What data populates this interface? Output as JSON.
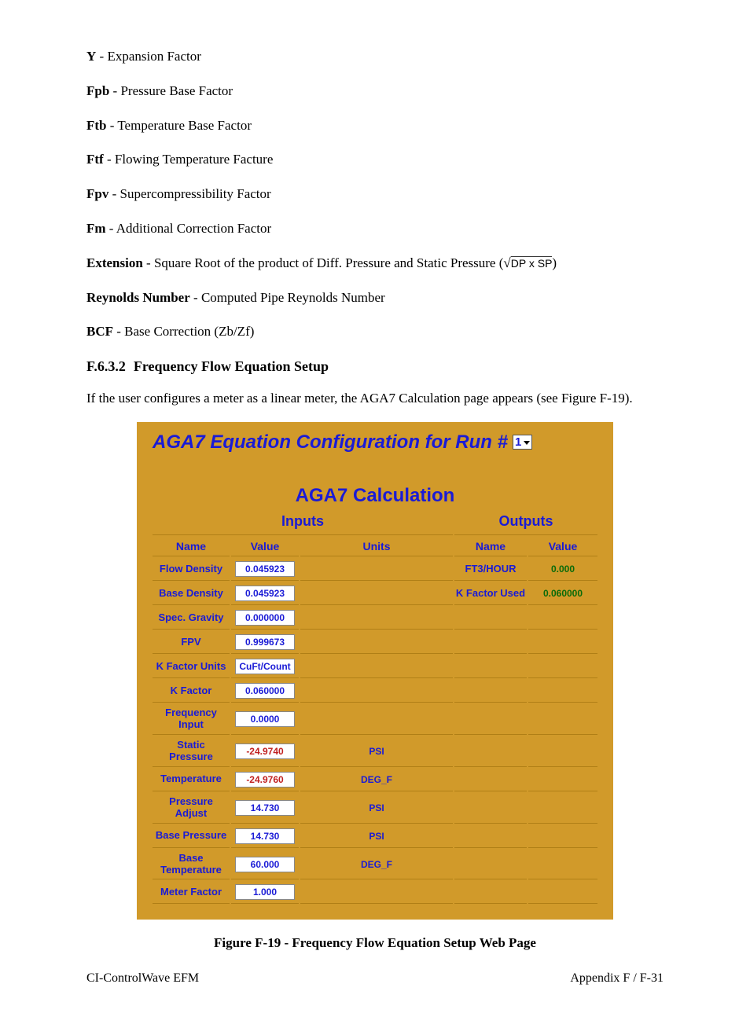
{
  "defs": [
    {
      "sym": "Y",
      "desc": "Expansion Factor"
    },
    {
      "sym": "Fpb",
      "desc": "Pressure Base Factor"
    },
    {
      "sym": "Ftb",
      "desc": "Temperature Base Factor"
    },
    {
      "sym": "Ftf",
      "desc": "Flowing Temperature Facture"
    },
    {
      "sym": "Fpv",
      "desc": "Supercompressibility Factor"
    },
    {
      "sym": "Fm",
      "desc": "Additional Correction Factor"
    }
  ],
  "ext": {
    "sym": "Extension",
    "desc": "Square Root of the product of Diff. Pressure and Static Pressure (",
    "sqrt": "DP x SP",
    "close": ")"
  },
  "reynolds": {
    "sym": "Reynolds Number",
    "desc": "Computed Pipe Reynolds Number"
  },
  "bcf": {
    "sym": "BCF",
    "desc": "Base Correction (Zb/Zf)"
  },
  "section": {
    "num": "F.6.3.2",
    "title": "Frequency Flow Equation Setup"
  },
  "para": "If the user configures a meter as a linear meter, the AGA7 Calculation page appears (see Figure F-19).",
  "aga7": {
    "title": "AGA7 Equation Configuration for Run #",
    "run": "1",
    "calc_title": "AGA7 Calculation",
    "inputs_hdr": "Inputs",
    "outputs_hdr": "Outputs",
    "col_name": "Name",
    "col_value": "Value",
    "col_units": "Units",
    "inputs": [
      {
        "name": "Flow Density",
        "value": "0.045923",
        "units": ""
      },
      {
        "name": "Base Density",
        "value": "0.045923",
        "units": ""
      },
      {
        "name": "Spec. Gravity",
        "value": "0.000000",
        "units": ""
      },
      {
        "name": "FPV",
        "value": "0.999673",
        "units": ""
      },
      {
        "name": "K Factor Units",
        "value": "CuFt/Count",
        "units": ""
      },
      {
        "name": "K Factor",
        "value": "0.060000",
        "units": ""
      },
      {
        "name": "Frequency Input",
        "value": "0.0000",
        "units": ""
      },
      {
        "name": "Static Pressure",
        "value": "-24.9740",
        "units": "PSI",
        "neg": true
      },
      {
        "name": "Temperature",
        "value": "-24.9760",
        "units": "DEG_F",
        "neg": true
      },
      {
        "name": "Pressure Adjust",
        "value": "14.730",
        "units": "PSI"
      },
      {
        "name": "Base Pressure",
        "value": "14.730",
        "units": "PSI"
      },
      {
        "name": "Base Temperature",
        "value": "60.000",
        "units": "DEG_F"
      },
      {
        "name": "Meter Factor",
        "value": "1.000",
        "units": ""
      }
    ],
    "outputs": [
      {
        "name": "FT3/HOUR",
        "value": "0.000"
      },
      {
        "name": "K Factor Used",
        "value": "0.060000"
      }
    ]
  },
  "caption": "Figure F-19 - Frequency Flow Equation Setup Web Page",
  "footer": {
    "left": "CI-ControlWave EFM",
    "right": "Appendix F / F-31"
  }
}
